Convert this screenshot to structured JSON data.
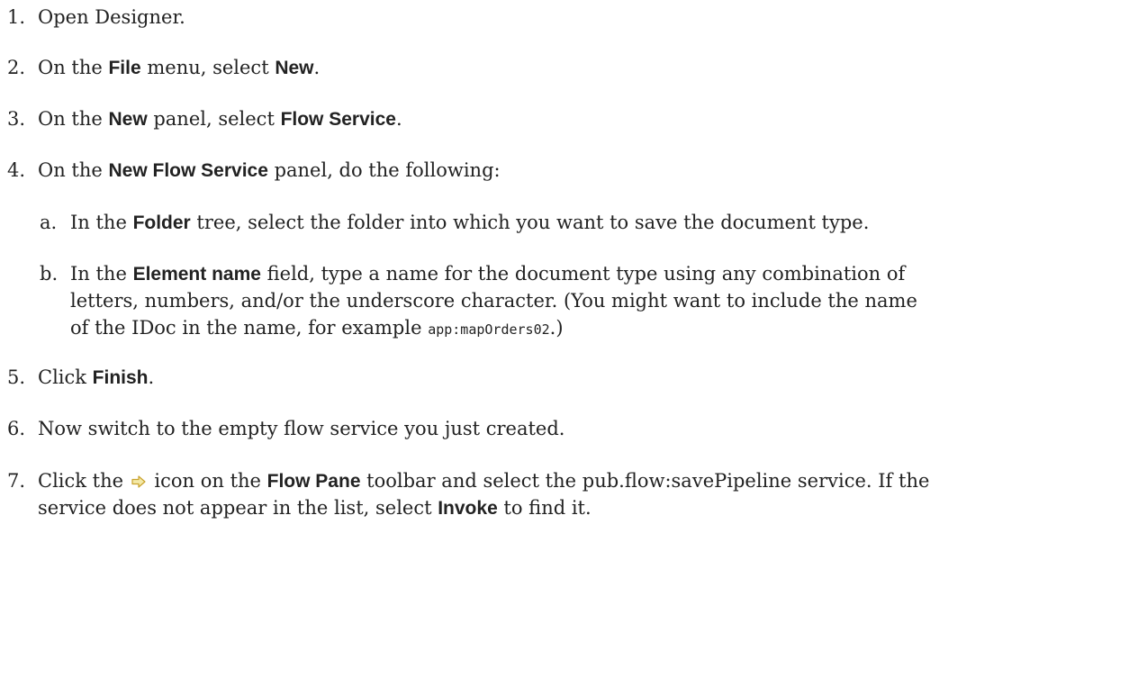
{
  "steps": [
    {
      "num": "1.",
      "t1": "Open Designer."
    },
    {
      "num": "2.",
      "t1": "On the ",
      "b1": "File",
      "t2": " menu, select ",
      "b2": "New",
      "t3": "."
    },
    {
      "num": "3.",
      "t1": "On the ",
      "b1": "New",
      "t2": " panel, select ",
      "b2": "Flow Service",
      "t3": "."
    },
    {
      "num": "4.",
      "t1": "On the ",
      "b1": "New Flow Service",
      "t2": " panel, do the following:"
    },
    {
      "num": "5.",
      "t1": "Click ",
      "b1": "Finish",
      "t2": "."
    },
    {
      "num": "6.",
      "t1": "Now switch to the empty flow service you just created."
    },
    {
      "num": "7.",
      "t1": "Click the ",
      "t2": " icon on the ",
      "b1": "Flow Pane",
      "t3": " toolbar and select the pub.flow:savePipeline service. If the",
      "t4": "service does not appear in the list, select ",
      "b2": "Invoke",
      "t5": " to find it."
    }
  ],
  "substeps": [
    {
      "num": "a.",
      "t1": "In the ",
      "b1": "Folder",
      "t2": " tree, select the folder into which you want to save the document type."
    },
    {
      "num": "b.",
      "l1a": "In the ",
      "l1b": "Element name",
      "l1c": " field, type a name for the document type using any combination of",
      "l2": "letters, numbers, and/or the underscore character. (You might want to include the name",
      "l3a": "of the IDoc in the name, for example ",
      "code": "app:mapOrders02",
      "l3b": ".)"
    }
  ],
  "icons": {
    "step7": "arrow-right-icon"
  },
  "colors": {
    "text": "#222222",
    "icon_fill": "#f3e9a8",
    "icon_stroke": "#c9a22c"
  }
}
